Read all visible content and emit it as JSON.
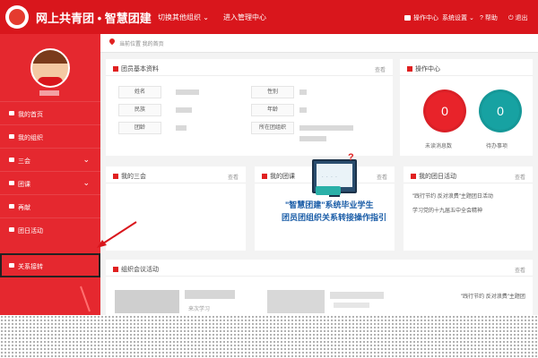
{
  "header": {
    "app_title": "网上共青团 • 智慧团建",
    "switch_org": "切换其他组织",
    "admin_center": "进入管理中心",
    "ops_center": "操作中心",
    "sys_settings": "系统设置",
    "help": "帮助",
    "logout": "退出"
  },
  "sidebar": {
    "items": [
      {
        "label": "我的首页",
        "has_children": false
      },
      {
        "label": "我的组织",
        "has_children": false
      },
      {
        "label": "三会",
        "has_children": true
      },
      {
        "label": "团课",
        "has_children": true
      },
      {
        "label": "再献",
        "has_children": false
      },
      {
        "label": "团日活动",
        "has_children": false
      },
      {
        "label": "关系接转",
        "has_children": false
      }
    ]
  },
  "breadcrumb": "当前位置 我的首页",
  "member_info": {
    "title": "团员基本资料",
    "more": "查看",
    "fields": [
      "姓名",
      "民族",
      "团龄",
      "性别",
      "年龄",
      "所在团组织"
    ]
  },
  "ops_panel": {
    "title": "操作中心",
    "unread_count": "0",
    "unread_label": "未读消息数",
    "todo_count": "0",
    "todo_label": "待办事项",
    "colors": {
      "unread": "#e8232a",
      "todo": "#17a2a2"
    }
  },
  "my_three": {
    "title": "我的三会",
    "more": "查看"
  },
  "my_lesson": {
    "title": "我的团课",
    "more": "查看"
  },
  "promo": {
    "line1": "\"智慧团建\"系统毕业学生",
    "line2": "团员团组织关系转接操作指引"
  },
  "my_activity": {
    "title": "我的团日活动",
    "more": "查看",
    "items": [
      "\"践行节约 反对浪费\"主题团日活动",
      "学习党的十九届五中全会精神"
    ]
  },
  "org_meetings": {
    "title": "组织会议活动",
    "more": "查看",
    "item_text": "\"践行节约 反对浪费\"主题团",
    "sub_text": "来次学习"
  },
  "colors": {
    "brand_red": "#d9161c"
  }
}
